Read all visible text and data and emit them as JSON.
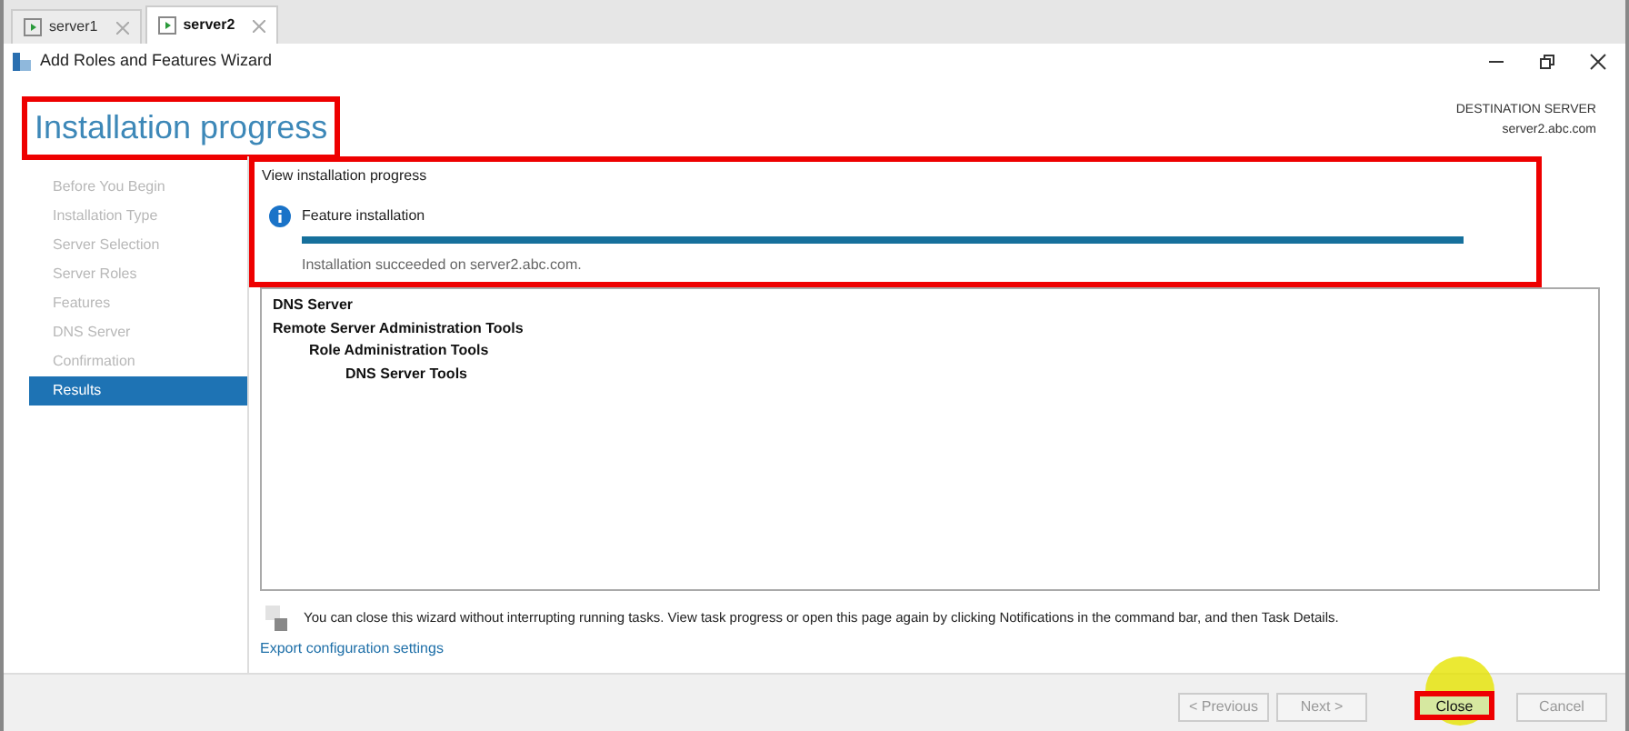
{
  "tabs": [
    {
      "label": "server1",
      "selected": false
    },
    {
      "label": "server2",
      "selected": true
    }
  ],
  "window": {
    "title": "Add Roles and Features Wizard"
  },
  "heading": "Installation progress",
  "destination": {
    "label": "DESTINATION SERVER",
    "server": "server2.abc.com"
  },
  "nav": [
    {
      "label": "Before You Begin",
      "selected": false
    },
    {
      "label": "Installation Type",
      "selected": false
    },
    {
      "label": "Server Selection",
      "selected": false
    },
    {
      "label": "Server Roles",
      "selected": false
    },
    {
      "label": "Features",
      "selected": false
    },
    {
      "label": "DNS Server",
      "selected": false
    },
    {
      "label": "Confirmation",
      "selected": false
    },
    {
      "label": "Results",
      "selected": true
    }
  ],
  "section_title": "View installation progress",
  "progress": {
    "label": "Feature installation",
    "level": 1,
    "message": "Installation succeeded on server2.abc.com."
  },
  "results": [
    {
      "label": "DNS Server"
    },
    {
      "label": "Remote Server Administration Tools",
      "children": [
        {
          "label": "Role Administration Tools",
          "children": [
            {
              "label": "DNS Server Tools"
            }
          ]
        }
      ]
    }
  ],
  "note": "You can close this wizard without interrupting running tasks. View task progress or open this page again by clicking Notifications in the command bar, and then Task Details.",
  "export_link": "Export configuration settings",
  "buttons": [
    {
      "label": "< Previous",
      "disabled": true
    },
    {
      "label": "Next >",
      "disabled": true
    },
    {
      "label": "Close",
      "disabled": false
    },
    {
      "label": "Cancel",
      "disabled": true
    }
  ]
}
